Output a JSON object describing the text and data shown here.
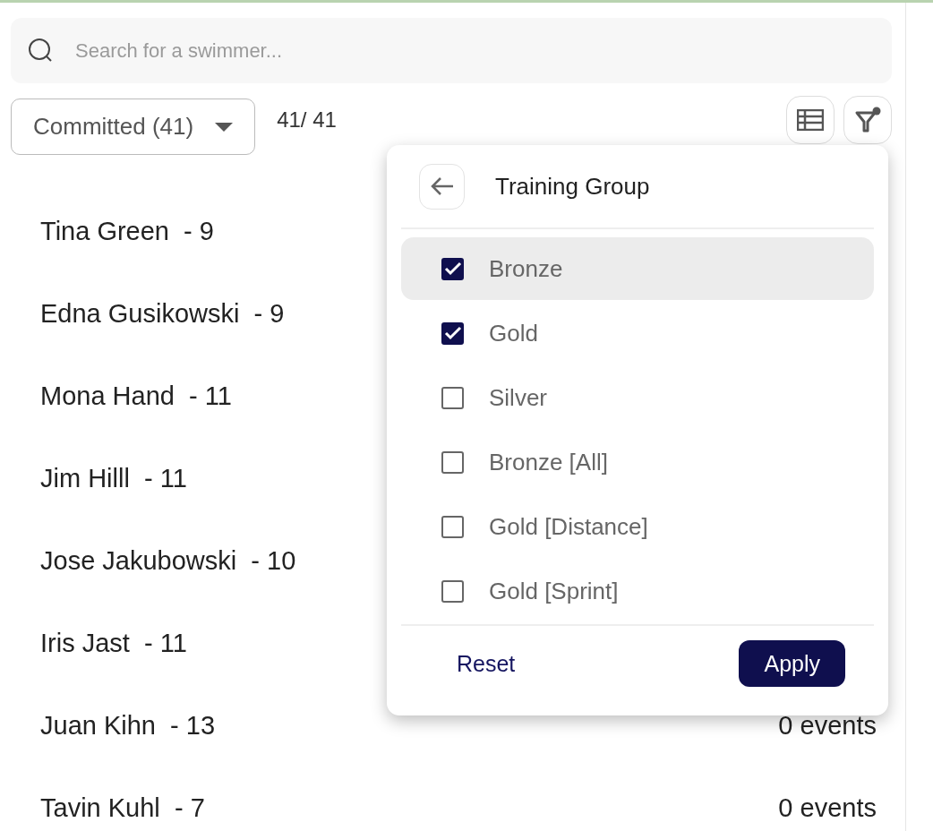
{
  "search": {
    "placeholder": "Search for a swimmer..."
  },
  "status_filter": {
    "label": "Committed (41)"
  },
  "count": "41/ 41",
  "toolbar": {
    "filter_active": true
  },
  "swimmers": [
    {
      "name": "Tina Green  - 9"
    },
    {
      "name": "Edna Gusikowski  - 9"
    },
    {
      "name": "Mona Hand  - 11"
    },
    {
      "name": "Jim Hilll  - 11"
    },
    {
      "name": "Jose Jakubowski  - 10"
    },
    {
      "name": "Iris Jast  - 11"
    },
    {
      "name": "Juan Kihn  - 13",
      "events": "0 events"
    },
    {
      "name": "Tavin Kuhl  - 7",
      "events": "0 events"
    }
  ],
  "filter_popup": {
    "title": "Training Group",
    "options": [
      {
        "label": "Bronze",
        "checked": true,
        "highlighted": true
      },
      {
        "label": "Gold",
        "checked": true,
        "highlighted": false
      },
      {
        "label": "Silver",
        "checked": false,
        "highlighted": false
      },
      {
        "label": "Bronze [All]",
        "checked": false,
        "highlighted": false
      },
      {
        "label": "Gold [Distance]",
        "checked": false,
        "highlighted": false
      },
      {
        "label": "Gold [Sprint]",
        "checked": false,
        "highlighted": false
      }
    ],
    "reset": "Reset",
    "apply": "Apply"
  }
}
